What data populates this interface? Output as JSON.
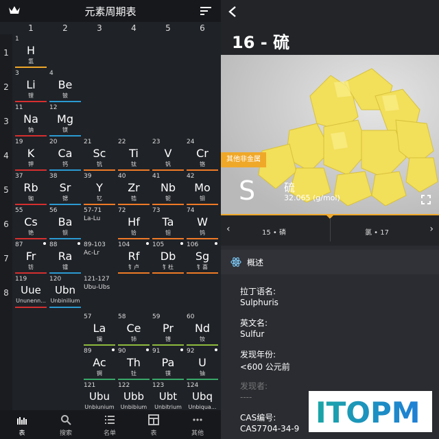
{
  "app": {
    "title": "元素周期表"
  },
  "table": {
    "columns": [
      "1",
      "2",
      "3",
      "4",
      "5",
      "6"
    ],
    "rows": [
      "1",
      "2",
      "3",
      "4",
      "5",
      "6",
      "7",
      "8"
    ],
    "cells": [
      {
        "n": "1",
        "s": "H",
        "c": "氢",
        "col": 0,
        "row": 0,
        "bar": "#f0a829"
      },
      {
        "n": "3",
        "s": "Li",
        "c": "锂",
        "col": 0,
        "row": 1,
        "bar": "#d62f2f"
      },
      {
        "n": "4",
        "s": "Be",
        "c": "铍",
        "col": 1,
        "row": 1,
        "bar": "#2b9bd3"
      },
      {
        "n": "11",
        "s": "Na",
        "c": "钠",
        "col": 0,
        "row": 2,
        "bar": "#d62f2f"
      },
      {
        "n": "12",
        "s": "Mg",
        "c": "镁",
        "col": 1,
        "row": 2,
        "bar": "#2b9bd3"
      },
      {
        "n": "19",
        "s": "K",
        "c": "钾",
        "col": 0,
        "row": 3,
        "bar": "#d62f2f"
      },
      {
        "n": "20",
        "s": "Ca",
        "c": "钙",
        "col": 1,
        "row": 3,
        "bar": "#2b9bd3"
      },
      {
        "n": "21",
        "s": "Sc",
        "c": "钪",
        "col": 2,
        "row": 3,
        "bar": "#f07a26"
      },
      {
        "n": "22",
        "s": "Ti",
        "c": "钛",
        "col": 3,
        "row": 3,
        "bar": "#f07a26"
      },
      {
        "n": "23",
        "s": "V",
        "c": "钒",
        "col": 4,
        "row": 3,
        "bar": "#f07a26"
      },
      {
        "n": "24",
        "s": "Cr",
        "c": "铬",
        "col": 5,
        "row": 3,
        "bar": "#f07a26"
      },
      {
        "n": "37",
        "s": "Rb",
        "c": "铷",
        "col": 0,
        "row": 4,
        "bar": "#d62f2f"
      },
      {
        "n": "38",
        "s": "Sr",
        "c": "锶",
        "col": 1,
        "row": 4,
        "bar": "#2b9bd3"
      },
      {
        "n": "39",
        "s": "Y",
        "c": "钇",
        "col": 2,
        "row": 4,
        "bar": "#f07a26"
      },
      {
        "n": "40",
        "s": "Zr",
        "c": "锆",
        "col": 3,
        "row": 4,
        "bar": "#f07a26"
      },
      {
        "n": "41",
        "s": "Nb",
        "c": "铌",
        "col": 4,
        "row": 4,
        "bar": "#f07a26"
      },
      {
        "n": "42",
        "s": "Mo",
        "c": "钼",
        "col": 5,
        "row": 4,
        "bar": "#f07a26"
      },
      {
        "n": "55",
        "s": "Cs",
        "c": "铯",
        "col": 0,
        "row": 5,
        "bar": "#d62f2f"
      },
      {
        "n": "56",
        "s": "Ba",
        "c": "钡",
        "col": 1,
        "row": 5,
        "bar": "#2b9bd3"
      },
      {
        "n": "72",
        "s": "Hf",
        "c": "铪",
        "col": 3,
        "row": 5,
        "bar": "#f07a26"
      },
      {
        "n": "73",
        "s": "Ta",
        "c": "钽",
        "col": 4,
        "row": 5,
        "bar": "#f07a26"
      },
      {
        "n": "74",
        "s": "W",
        "c": "钨",
        "col": 5,
        "row": 5,
        "bar": "#f07a26"
      },
      {
        "n": "87",
        "s": "Fr",
        "c": "钫",
        "col": 0,
        "row": 6,
        "bar": "#d62f2f",
        "dot": true
      },
      {
        "n": "88",
        "s": "Ra",
        "c": "镭",
        "col": 1,
        "row": 6,
        "bar": "#2b9bd3",
        "dot": true
      },
      {
        "n": "104",
        "s": "Rf",
        "c": "钅卢",
        "col": 3,
        "row": 6,
        "bar": "#f07a26",
        "dot": true
      },
      {
        "n": "105",
        "s": "Db",
        "c": "钅杜",
        "col": 4,
        "row": 6,
        "bar": "#f07a26",
        "dot": true
      },
      {
        "n": "106",
        "s": "Sg",
        "c": "钅喜",
        "col": 5,
        "row": 6,
        "bar": "#f07a26",
        "dot": true
      },
      {
        "n": "119",
        "s": "Uue",
        "c": "Ununenn...",
        "col": 0,
        "row": 7,
        "bar": "#d62f2f",
        "wide": true
      },
      {
        "n": "120",
        "s": "Ubn",
        "c": "Unbinilium",
        "col": 1,
        "row": 7,
        "bar": "#2b9bd3",
        "wide": true
      },
      {
        "n": "57",
        "s": "La",
        "c": "镧",
        "col": 2,
        "row": 8,
        "bar": "#8fba3e"
      },
      {
        "n": "58",
        "s": "Ce",
        "c": "铈",
        "col": 3,
        "row": 8,
        "bar": "#8fba3e"
      },
      {
        "n": "59",
        "s": "Pr",
        "c": "镨",
        "col": 4,
        "row": 8,
        "bar": "#8fba3e"
      },
      {
        "n": "60",
        "s": "Nd",
        "c": "钕",
        "col": 5,
        "row": 8,
        "bar": "#8fba3e"
      },
      {
        "n": "89",
        "s": "Ac",
        "c": "锕",
        "col": 2,
        "row": 9,
        "bar": "#3aa96a",
        "dot": true
      },
      {
        "n": "90",
        "s": "Th",
        "c": "钍",
        "col": 3,
        "row": 9,
        "bar": "#3aa96a",
        "dot": true
      },
      {
        "n": "91",
        "s": "Pa",
        "c": "镤",
        "col": 4,
        "row": 9,
        "bar": "#3aa96a",
        "dot": true
      },
      {
        "n": "92",
        "s": "U",
        "c": "铀",
        "col": 5,
        "row": 9,
        "bar": "#3aa96a",
        "dot": true
      },
      {
        "n": "121",
        "s": "Ubu",
        "c": "Unbiunium",
        "col": 2,
        "row": 10,
        "bar": "#3aa96a",
        "wide": true
      },
      {
        "n": "122",
        "s": "Ubb",
        "c": "Unbibium",
        "col": 3,
        "row": 10,
        "bar": "#3aa96a",
        "wide": true
      },
      {
        "n": "123",
        "s": "Ubt",
        "c": "Unbitrium",
        "col": 4,
        "row": 10,
        "bar": "#3aa96a",
        "wide": true
      },
      {
        "n": "124",
        "s": "Ubq",
        "c": "Unbiqua...",
        "col": 5,
        "row": 10,
        "bar": "#3aa96a",
        "wide": true
      }
    ],
    "ranges": [
      {
        "n": "57-71",
        "r": "La-Lu",
        "col": 2,
        "row": 5
      },
      {
        "n": "89-103",
        "r": "Ac-Lr",
        "col": 2,
        "row": 6
      },
      {
        "n": "121-127",
        "r": "Ubu-Ubs",
        "col": 2,
        "row": 7
      }
    ]
  },
  "tabs": [
    {
      "label": "表",
      "icon": "table-chart-icon"
    },
    {
      "label": "搜索",
      "icon": "search-icon"
    },
    {
      "label": "名单",
      "icon": "list-icon"
    },
    {
      "label": "表",
      "icon": "grid-icon"
    },
    {
      "label": "其他",
      "icon": "more-icon"
    }
  ],
  "detail": {
    "title": "16 - 硫",
    "category": "其他非金属",
    "symbol": "S",
    "name_cn": "硫",
    "mass": "32.065 (g/mol)",
    "prev": {
      "label": "15 • 磷"
    },
    "next": {
      "label": "氯 • 17"
    },
    "section": "概述",
    "fields": [
      {
        "label": "拉丁语名:",
        "value": "Sulphuris",
        "dim": false
      },
      {
        "label": "英文名:",
        "value": "Sulfur",
        "dim": false
      },
      {
        "label": "发现年份:",
        "value": "<600 公元前",
        "dim": false
      },
      {
        "label": "发现者:",
        "value": "----",
        "dim": true
      },
      {
        "label": "CAS编号:",
        "value": "CAS7704-34-9",
        "dim": false
      }
    ]
  },
  "watermark": {
    "text": "ITOPM"
  },
  "colors": {
    "accent": "#f0a829",
    "alkali": "#d62f2f",
    "alkaline": "#2b9bd3",
    "transition": "#f07a26",
    "lanthanide": "#8fba3e",
    "actinide": "#3aa96a"
  }
}
